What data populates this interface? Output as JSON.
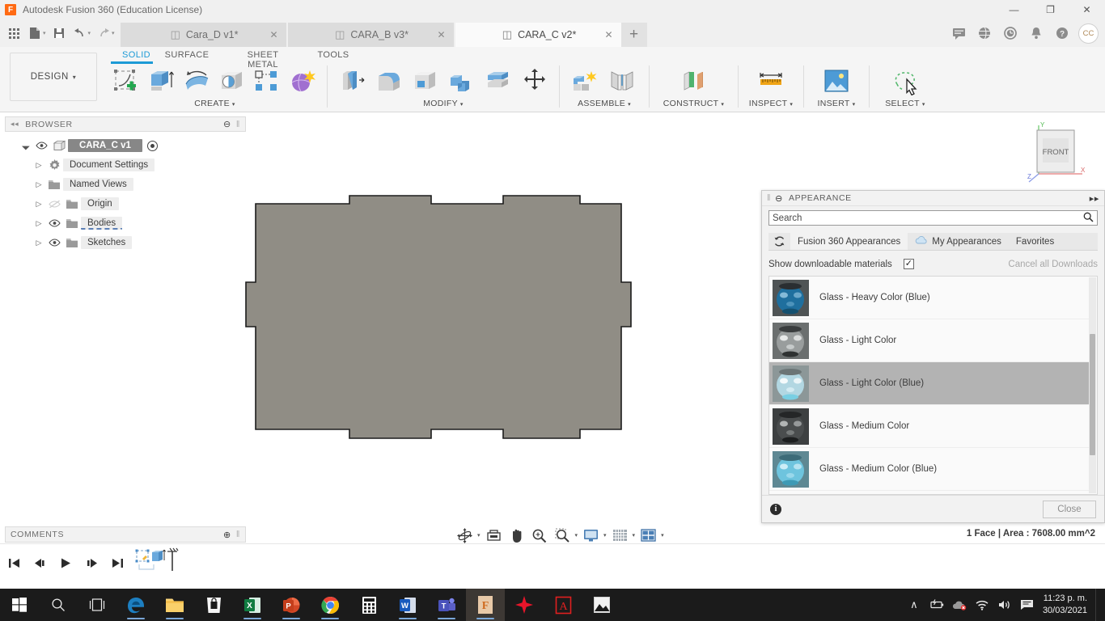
{
  "titlebar": {
    "app_title": "Autodesk Fusion 360 (Education License)",
    "logo_letter": "F",
    "minimize": "—",
    "maximize": "❐",
    "close": "✕"
  },
  "quick_access": [
    {
      "name": "app-grid",
      "icon": "grid-icon"
    },
    {
      "name": "new-file",
      "icon": "file-icon",
      "caret": "▾"
    },
    {
      "name": "save",
      "icon": "save-icon"
    },
    {
      "name": "undo",
      "icon": "undo-icon",
      "caret": "▾"
    },
    {
      "name": "redo",
      "icon": "redo-icon",
      "caret": "▾"
    }
  ],
  "doc_tabs": [
    {
      "label": "Cara_D v1*",
      "active": false,
      "close": "✕"
    },
    {
      "label": "CARA_B v3*",
      "active": false,
      "close": "✕"
    },
    {
      "label": "CARA_C v2*",
      "active": true,
      "close": "✕"
    }
  ],
  "tab_actions": {
    "new_tab": "+",
    "icons": [
      "comment-icon",
      "globe-icon",
      "clock-icon",
      "bell-icon",
      "help-icon"
    ],
    "avatar_initials": "CC"
  },
  "ribbon": {
    "design_label": "DESIGN",
    "design_caret": "▾",
    "workspace_tabs": [
      {
        "label": "SOLID",
        "active": true
      },
      {
        "label": "SURFACE",
        "active": false
      },
      {
        "label": "SHEET METAL",
        "active": false
      },
      {
        "label": "TOOLS",
        "active": false
      }
    ],
    "panels": [
      {
        "label": "CREATE",
        "caret": "▾",
        "tools": [
          "create-sketch",
          "extrude",
          "revolve",
          "hole",
          "rectangular-pattern",
          "form"
        ]
      },
      {
        "label": "MODIFY",
        "caret": "▾",
        "tools": [
          "press-pull",
          "fillet",
          "shell",
          "combine",
          "offset-face",
          "move-copy"
        ]
      },
      {
        "label": "ASSEMBLE",
        "caret": "▾",
        "tools": [
          "new-component",
          "joint"
        ]
      },
      {
        "label": "CONSTRUCT",
        "caret": "▾",
        "tools": [
          "offset-plane"
        ]
      },
      {
        "label": "INSPECT",
        "caret": "▾",
        "tools": [
          "measure"
        ]
      },
      {
        "label": "INSERT",
        "caret": "▾",
        "tools": [
          "insert-canvas"
        ]
      },
      {
        "label": "SELECT",
        "caret": "▾",
        "tools": [
          "select-lasso"
        ]
      }
    ]
  },
  "browser": {
    "title": "BROWSER",
    "collapse_icon": "◂◂",
    "minimize_icon": "⊖",
    "grip_icon": "‖",
    "items": [
      {
        "label": "CARA_C v1",
        "arrow": "◢",
        "has_eye": true,
        "icon": "cube-icon",
        "root": true,
        "radio": true,
        "depth": 0
      },
      {
        "label": "Document Settings",
        "arrow": "▷",
        "has_eye": false,
        "icon": "gear-icon",
        "depth": 1
      },
      {
        "label": "Named Views",
        "arrow": "▷",
        "has_eye": false,
        "icon": "folder-icon",
        "depth": 1
      },
      {
        "label": "Origin",
        "arrow": "▷",
        "has_eye": true,
        "eye_off": true,
        "icon": "folder-icon",
        "depth": 1
      },
      {
        "label": "Bodies",
        "arrow": "▷",
        "has_eye": true,
        "icon": "folder-icon",
        "depth": 1,
        "underline": true
      },
      {
        "label": "Sketches",
        "arrow": "▷",
        "has_eye": true,
        "icon": "folder-icon",
        "depth": 1
      }
    ]
  },
  "viewcube": {
    "face_label": "FRONT",
    "axis_x": "X",
    "axis_y": "Y",
    "axis_z": "Z"
  },
  "appearance": {
    "title": "APPEARANCE",
    "grip_icon": "‖",
    "minimize_icon": "⊖",
    "expand_icon": "▸▸",
    "search_value": "Search",
    "search_placeholder": "Search",
    "search_icon": "search-icon",
    "refresh_icon": "refresh-icon",
    "library_tabs": [
      {
        "label": "Fusion 360 Appearances",
        "active": true,
        "icon": null
      },
      {
        "label": "My Appearances",
        "active": false,
        "icon": "cloud-icon"
      },
      {
        "label": "Favorites",
        "active": false,
        "icon": null
      }
    ],
    "show_downloadable_label": "Show downloadable materials",
    "show_downloadable_checked": true,
    "check_glyph": "✓",
    "cancel_downloads_label": "Cancel all Downloads",
    "materials": [
      {
        "name": "Glass - Heavy Color (Blue)",
        "selected": false,
        "swatch_color": "#1f6f9e",
        "swatch_bg": "#4f5455"
      },
      {
        "name": "Glass - Light Color",
        "selected": false,
        "swatch_color": "#cfd2d2",
        "swatch_bg": "#6b6f6f"
      },
      {
        "name": "Glass - Light Color (Blue)",
        "selected": true,
        "swatch_color": "#b8e2ef",
        "swatch_bg": "#8c9798"
      },
      {
        "name": "Glass - Medium Color",
        "selected": false,
        "swatch_color": "#4a4d4e",
        "swatch_bg": "#3d4041"
      },
      {
        "name": "Glass - Medium Color (Blue)",
        "selected": false,
        "swatch_color": "#6ec4de",
        "swatch_bg": "#5e8893"
      }
    ],
    "info_glyph": "i",
    "close_label": "Close"
  },
  "status": {
    "text": "1 Face | Area : 7608.00 mm^2"
  },
  "comments": {
    "title": "COMMENTS",
    "add_icon": "⊕",
    "grip_icon": "‖"
  },
  "navbar": {
    "tools": [
      {
        "name": "orbit",
        "caret": "▾"
      },
      {
        "name": "look-at",
        "caret": null
      },
      {
        "name": "pan",
        "caret": null
      },
      {
        "name": "zoom",
        "caret": null
      },
      {
        "name": "zoom-window",
        "caret": "▾"
      },
      {
        "name": "display-settings",
        "caret": "▾"
      },
      {
        "name": "grid-snaps",
        "caret": "▾"
      },
      {
        "name": "viewports",
        "caret": "▾"
      }
    ]
  },
  "timeline": {
    "buttons": [
      "go-to-beginning",
      "step-back",
      "play",
      "step-forward",
      "go-to-end"
    ],
    "markers": [
      "sketch-marker",
      "extrude-marker"
    ]
  },
  "taskbar": {
    "items": [
      {
        "name": "start-button",
        "label": "Windows"
      },
      {
        "name": "search-button",
        "label": "Search"
      },
      {
        "name": "task-view-button",
        "label": "Task View"
      },
      {
        "name": "edge",
        "label": "Microsoft Edge",
        "running": true
      },
      {
        "name": "file-explorer",
        "label": "File Explorer",
        "running": true
      },
      {
        "name": "microsoft-store",
        "label": "Microsoft Store",
        "running": false
      },
      {
        "name": "excel",
        "label": "Excel",
        "running": true
      },
      {
        "name": "powerpoint",
        "label": "PowerPoint",
        "running": true
      },
      {
        "name": "chrome",
        "label": "Google Chrome",
        "running": true
      },
      {
        "name": "calculator",
        "label": "Calculator",
        "running": false
      },
      {
        "name": "word",
        "label": "Word",
        "running": true
      },
      {
        "name": "teams",
        "label": "Microsoft Teams",
        "running": true
      },
      {
        "name": "fusion360",
        "label": "Fusion 360",
        "running": true,
        "active": true
      },
      {
        "name": "red-app",
        "label": "App",
        "running": false
      },
      {
        "name": "acrobat",
        "label": "Adobe Acrobat",
        "running": false
      },
      {
        "name": "photos",
        "label": "Photos",
        "running": false
      }
    ],
    "tray": {
      "chevron": "∧",
      "icons": [
        "battery-icon",
        "onedrive-offline-icon",
        "wifi-icon",
        "volume-icon",
        "action-center-icon"
      ],
      "time": "11:23 p. m.",
      "date": "30/03/2021"
    }
  },
  "model": {
    "fill_color": "#8f8c84",
    "edge_color": "#1c1c1c",
    "shape_name": "tabbed-rectangular-face"
  }
}
